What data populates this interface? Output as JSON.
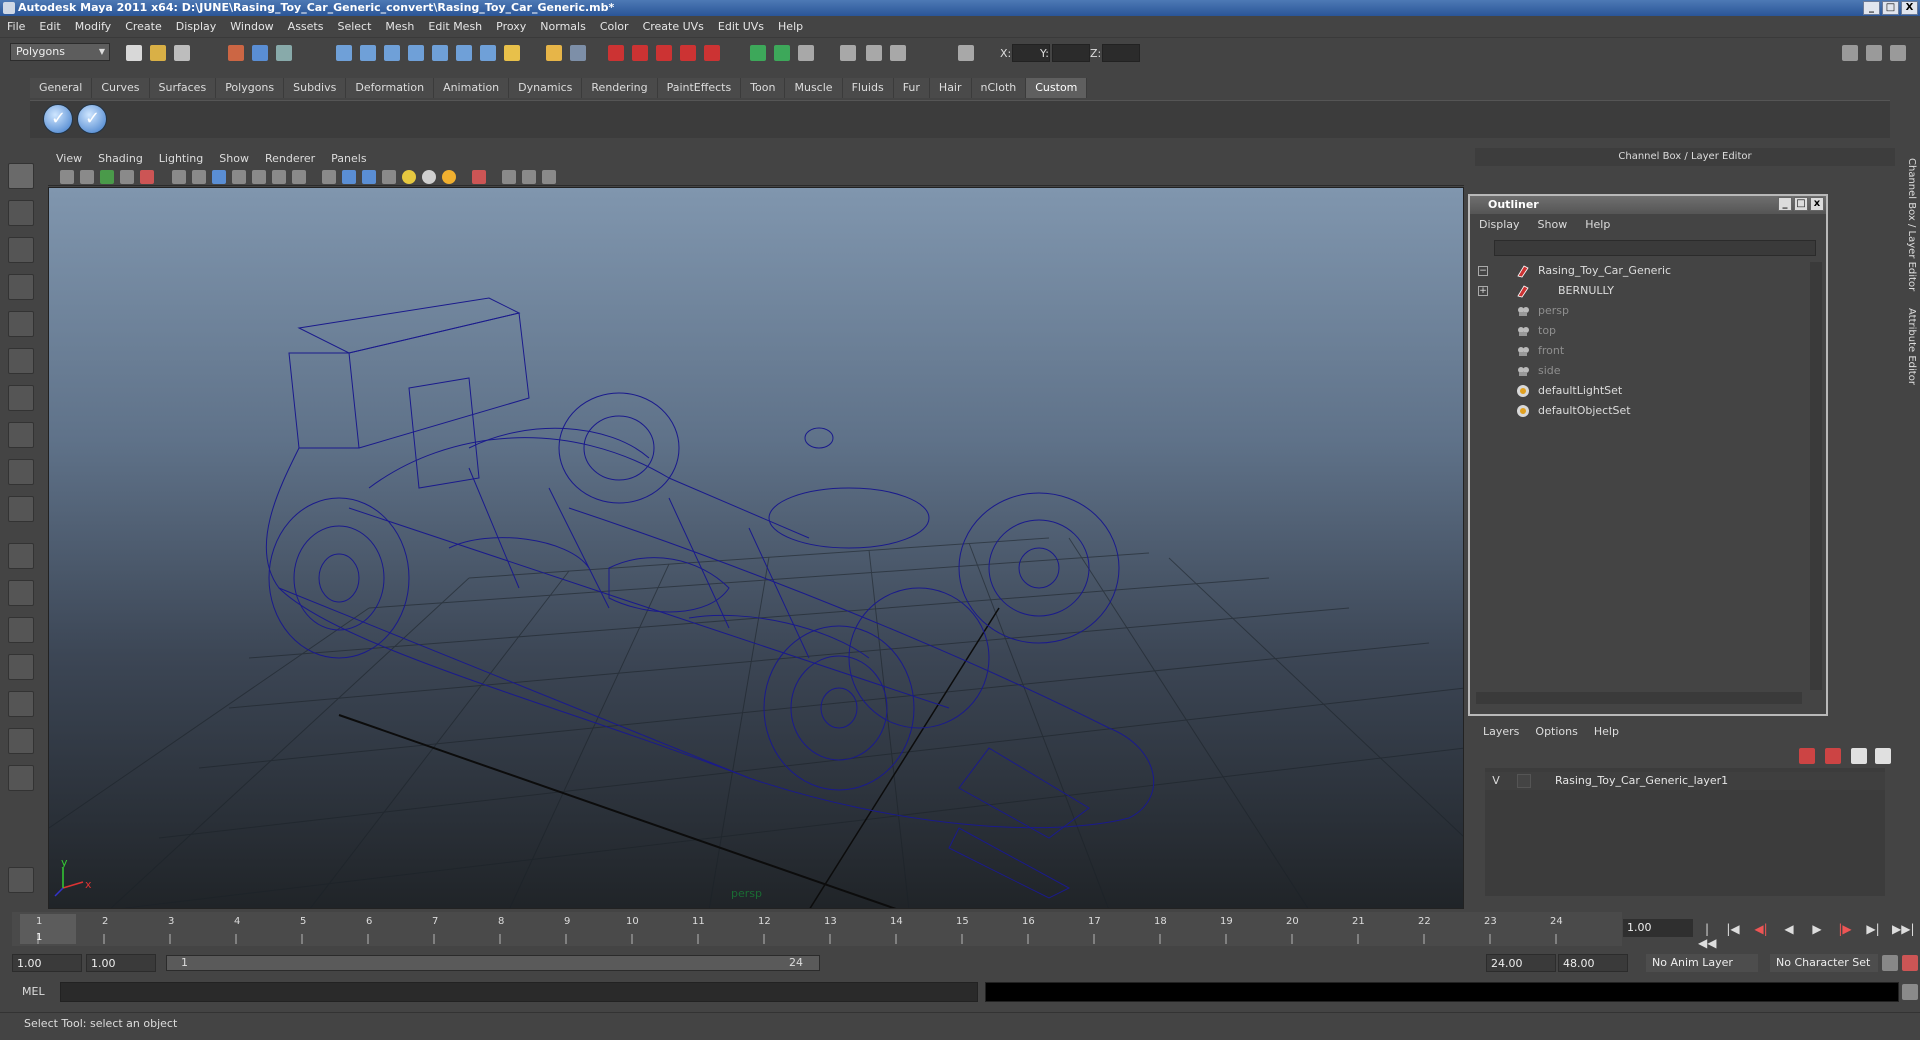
{
  "window": {
    "title": "Autodesk Maya 2011 x64: D:\\JUNE\\Rasing_Toy_Car_Generic_convert\\Rasing_Toy_Car_Generic.mb*",
    "controls": [
      "_",
      "□",
      "X"
    ]
  },
  "menubar": [
    "File",
    "Edit",
    "Modify",
    "Create",
    "Display",
    "Window",
    "Assets",
    "Select",
    "Mesh",
    "Edit Mesh",
    "Proxy",
    "Normals",
    "Color",
    "Create UVs",
    "Edit UVs",
    "Help"
  ],
  "statusline": {
    "mode": "Polygons",
    "x_label": "X:",
    "y_label": "Y:",
    "z_label": "Z:"
  },
  "shelf": {
    "tabs": [
      "General",
      "Curves",
      "Surfaces",
      "Polygons",
      "Subdivs",
      "Deformation",
      "Animation",
      "Dynamics",
      "Rendering",
      "PaintEffects",
      "Toon",
      "Muscle",
      "Fluids",
      "Fur",
      "Hair",
      "nCloth",
      "Custom"
    ],
    "active_tab": "Custom"
  },
  "viewport": {
    "menu": [
      "View",
      "Shading",
      "Lighting",
      "Show",
      "Renderer",
      "Panels"
    ],
    "camera": "persp",
    "axis_labels": {
      "y": "y",
      "x": "x"
    },
    "wire_color": "#1a1a8c"
  },
  "channel_box": {
    "title": "Channel Box / Layer Editor",
    "side_tabs": [
      "Channel Box / Layer Editor",
      "Attribute Editor"
    ]
  },
  "outliner": {
    "title": "Outliner",
    "menu": [
      "Display",
      "Show",
      "Help"
    ],
    "items": [
      {
        "label": "Rasing_Toy_Car_Generic",
        "expander": "−",
        "icon": "transform-icon",
        "dim": false
      },
      {
        "label": "BERNULLY",
        "expander": "+",
        "icon": "transform-icon",
        "dim": false
      },
      {
        "label": "persp",
        "expander": "",
        "icon": "camera-icon",
        "dim": true
      },
      {
        "label": "top",
        "expander": "",
        "icon": "camera-icon",
        "dim": true
      },
      {
        "label": "front",
        "expander": "",
        "icon": "camera-icon",
        "dim": true
      },
      {
        "label": "side",
        "expander": "",
        "icon": "camera-icon",
        "dim": true
      },
      {
        "label": "defaultLightSet",
        "expander": "",
        "icon": "set-icon",
        "dim": false
      },
      {
        "label": "defaultObjectSet",
        "expander": "",
        "icon": "set-icon",
        "dim": false
      }
    ]
  },
  "layers": {
    "menu": [
      "Layers",
      "Options",
      "Help"
    ],
    "rows": [
      {
        "visible": "V",
        "name": "Rasing_Toy_Car_Generic_layer1"
      }
    ]
  },
  "timeline": {
    "ticks": [
      "1",
      "2",
      "3",
      "4",
      "5",
      "6",
      "7",
      "8",
      "9",
      "10",
      "11",
      "12",
      "13",
      "14",
      "15",
      "16",
      "17",
      "18",
      "19",
      "20",
      "21",
      "22",
      "23",
      "24"
    ],
    "current_marker": "1",
    "current_frame": "1.00",
    "playback_buttons": [
      "|◀◀",
      "|◀",
      "◀|",
      "◀",
      "▶",
      "|▶",
      "▶|",
      "▶▶|"
    ]
  },
  "range": {
    "start_time": "1.00",
    "playback_start": "1.00",
    "slider_start": "1",
    "slider_end": "24",
    "playback_end": "24.00",
    "end_time": "48.00",
    "anim_layer": "No Anim Layer",
    "character_set": "No Character Set"
  },
  "command_line": {
    "label": "MEL"
  },
  "help_line": "Select Tool: select an object"
}
